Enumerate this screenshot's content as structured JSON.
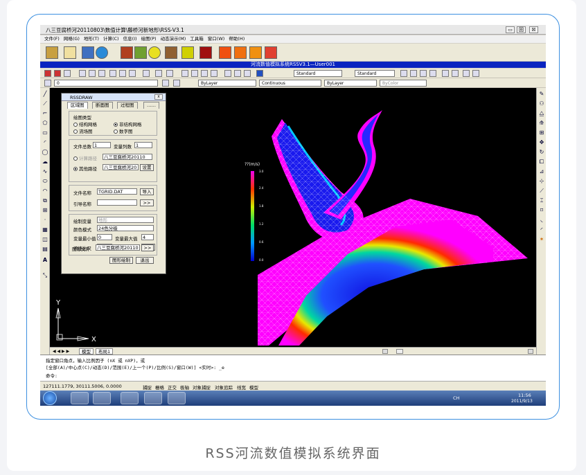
{
  "window": {
    "title": "八三豆腐桥河20110803\\数值计算\\藤桥河新地形\\RSS-V3.1",
    "min": "▭",
    "max": "回",
    "close": "☒"
  },
  "menu": [
    "文件(F)",
    "网格(G)",
    "地形(T)",
    "计算(C)",
    "信息(I)",
    "绘图(P)",
    "动态演示(M)",
    "工具箱",
    "窗口(W)",
    "帮助(H)"
  ],
  "app_banner": "河流数值模拟系统RSSV3.1—User001",
  "toolbar": {
    "text_style_1": "Standard",
    "text_style_2": "Standard",
    "layer": "ByLayer",
    "linetype": "Continuous",
    "lineweight": "ByLayer",
    "color": "ByColor",
    "layer_num": "0"
  },
  "dialog": {
    "title": "RSSDRAW",
    "tabs": [
      "区域图",
      "断面图",
      "过程图",
      "……"
    ],
    "plot_type_label": "绘图类型",
    "plot_types": [
      "结构网格",
      "非结构网格",
      "流场图",
      "数字图"
    ],
    "file_total_label": "文件总数",
    "file_total": "1",
    "var_cols_label": "变量列数",
    "var_cols": "1",
    "calc_path_label": "计算路径",
    "calc_path": "八三豆腐桥河20110",
    "other_path_label": "其他路径",
    "other_path": "八三豆腐桥河20",
    "set_label": "设置",
    "filename_label": "文件名称",
    "filename": "TGRID.DAT",
    "import_label": "导入",
    "guide_label": "引导名称",
    "guide_btn": ">>",
    "var_label": "绘制变量",
    "var_value": "地形",
    "color_mode_label": "颜色模式",
    "color_mode": "24色分级",
    "var_min_label": "变量最小值",
    "var_min": "0",
    "var_max_label": "变量最大值",
    "var_max": "4",
    "scale_label": "流速比尺",
    "scale": "20",
    "scale_set": "设置",
    "image_file_label": "图形文件",
    "image_file": "八三豆腐桥河20110",
    "image_btn": ">>",
    "draw_btn": "图形绘制",
    "exit_btn": "退出"
  },
  "legend": {
    "unit": "??(m/s)",
    "ticks": [
      "0.0",
      "0.6",
      "1.2",
      "1.8",
      "2.4",
      "3.0"
    ]
  },
  "axes": {
    "x": "X",
    "y": "Y"
  },
  "layout_tabs": [
    "模型",
    "布局1"
  ],
  "command": {
    "line1": "指定窗口角点，输入比例因子 (nX 或 nXP)，或",
    "line2": "[全部(A)/中心点(C)/动态(D)/范围(E)/上一个(P)/比例(S)/窗口(W)] <实时>: _e",
    "line3": "命令:"
  },
  "status": {
    "coords": "127111.1779, 30111.5006, 0.0000",
    "toggles": [
      "捕捉",
      "栅格",
      "正交",
      "极轴",
      "对象捕捉",
      "对象追踪",
      "线宽",
      "模型"
    ]
  },
  "clock": {
    "time": "11:56",
    "date": "2011/9/13",
    "ime": "CH"
  },
  "caption": "RSS河流数值模拟系统界面"
}
